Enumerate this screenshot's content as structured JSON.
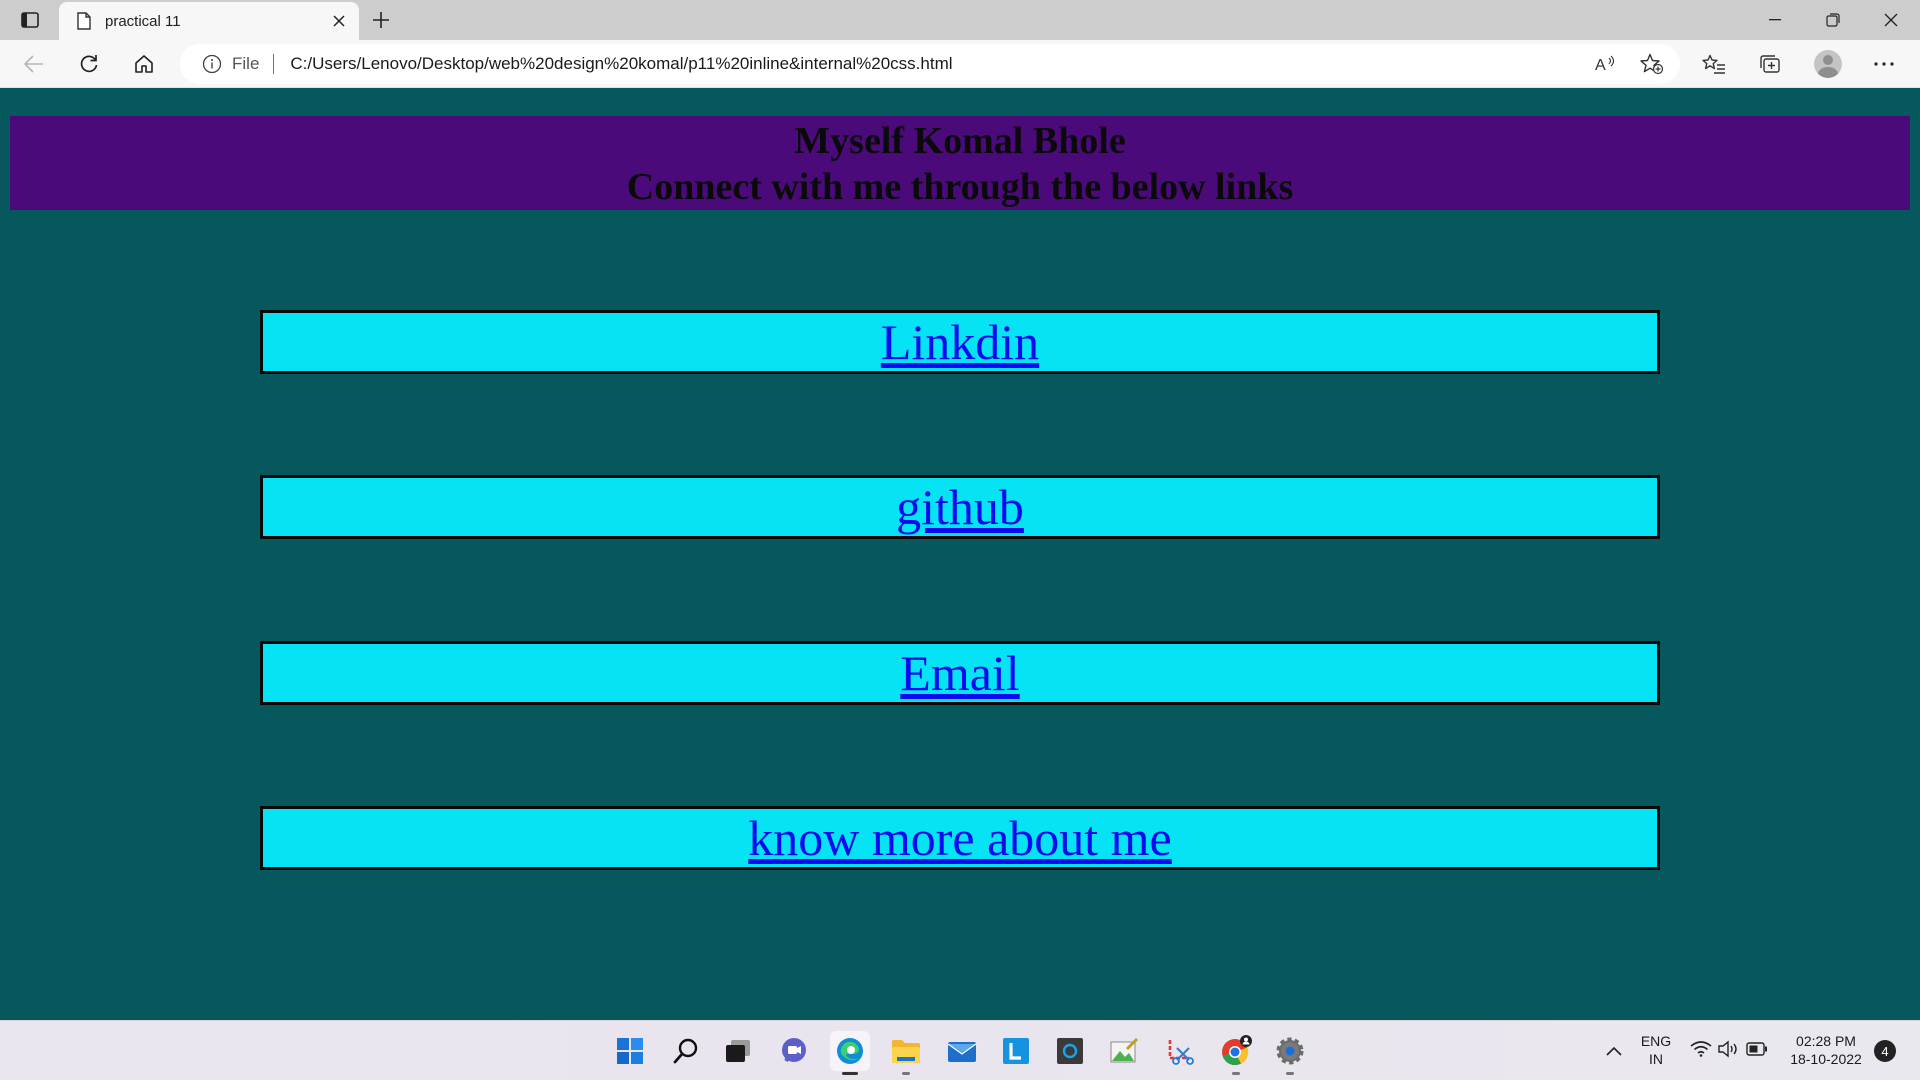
{
  "browser": {
    "tab": {
      "title": "practical 11"
    },
    "address": {
      "scheme": "File",
      "url": "C:/Users/Lenovo/Desktop/web%20design%20komal/p11%20inline&internal%20css.html"
    }
  },
  "page": {
    "heading_line1": "Myself Komal Bhole",
    "heading_line2": "Connect with me through the below links",
    "links": [
      {
        "label": "Linkdin"
      },
      {
        "label": "github"
      },
      {
        "label": "Email"
      },
      {
        "label": "know more about me"
      }
    ],
    "colors": {
      "background": "#06585c",
      "header": "#4b0a7a",
      "link_box": "#06e3f5",
      "link_text": "#0b0bf0"
    }
  },
  "taskbar": {
    "apps": [
      "windows-start",
      "search",
      "task-view",
      "teams-chat",
      "edge",
      "file-explorer",
      "mail",
      "lenovo-vantage",
      "cortana",
      "photo-editor",
      "snipping-tool",
      "chrome",
      "settings"
    ],
    "language": {
      "line1": "ENG",
      "line2": "IN"
    },
    "clock": {
      "time": "02:28 PM",
      "date": "18-10-2022"
    },
    "notifications": "4"
  }
}
